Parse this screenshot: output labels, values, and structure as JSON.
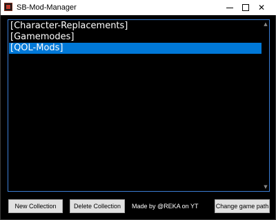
{
  "window": {
    "title": "SB-Mod-Manager",
    "controls": {
      "minimize": "minimize",
      "maximize": "maximize",
      "close": "✕"
    }
  },
  "collections": {
    "items": [
      {
        "label": "[Character-Replacements]",
        "selected": false
      },
      {
        "label": "[Gamemodes]",
        "selected": false
      },
      {
        "label": "[QOL-Mods]",
        "selected": true
      }
    ],
    "scroll_up": "▲",
    "scroll_down": "▼"
  },
  "footer": {
    "new_collection_label": "New Collection",
    "delete_collection_label": "Delete Collection",
    "credit": "Made by @REKA on YT",
    "change_path_label": "Change game path"
  },
  "colors": {
    "selection": "#0078d7",
    "list_border": "#3c7fd6",
    "background": "#000000"
  }
}
